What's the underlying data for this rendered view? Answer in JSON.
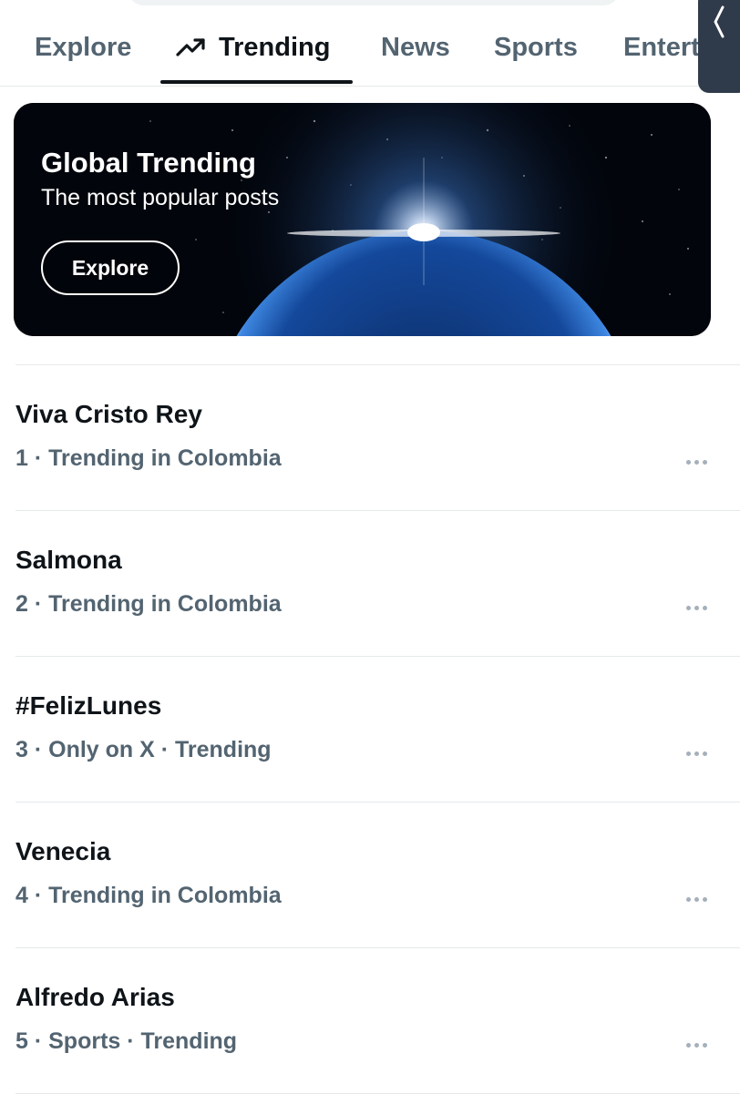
{
  "tabs": [
    {
      "label": "Explore"
    },
    {
      "label": "Trending",
      "icon": "trending-up-icon"
    },
    {
      "label": "News"
    },
    {
      "label": "Sports"
    },
    {
      "label": "Entert"
    }
  ],
  "active_tab": "Trending",
  "hero": {
    "title": "Global Trending",
    "subtitle": "The most popular posts",
    "button_label": "Explore"
  },
  "trends": [
    {
      "name": "Viva Cristo Rey",
      "meta": "1 · Trending in Colombia"
    },
    {
      "name": "Salmona",
      "meta": "2 · Trending in Colombia"
    },
    {
      "name": "#FelizLunes",
      "meta": "3 · Only on X · Trending"
    },
    {
      "name": "Venecia",
      "meta": "4 · Trending in Colombia"
    },
    {
      "name": "Alfredo Arias",
      "meta": "5 · Sports · Trending"
    }
  ],
  "colors": {
    "text_primary": "#0f1419",
    "text_secondary": "#536471",
    "divider": "#e6e9ea",
    "more_dots": "#a4b0bb",
    "drawer": "#2f3a4a"
  }
}
